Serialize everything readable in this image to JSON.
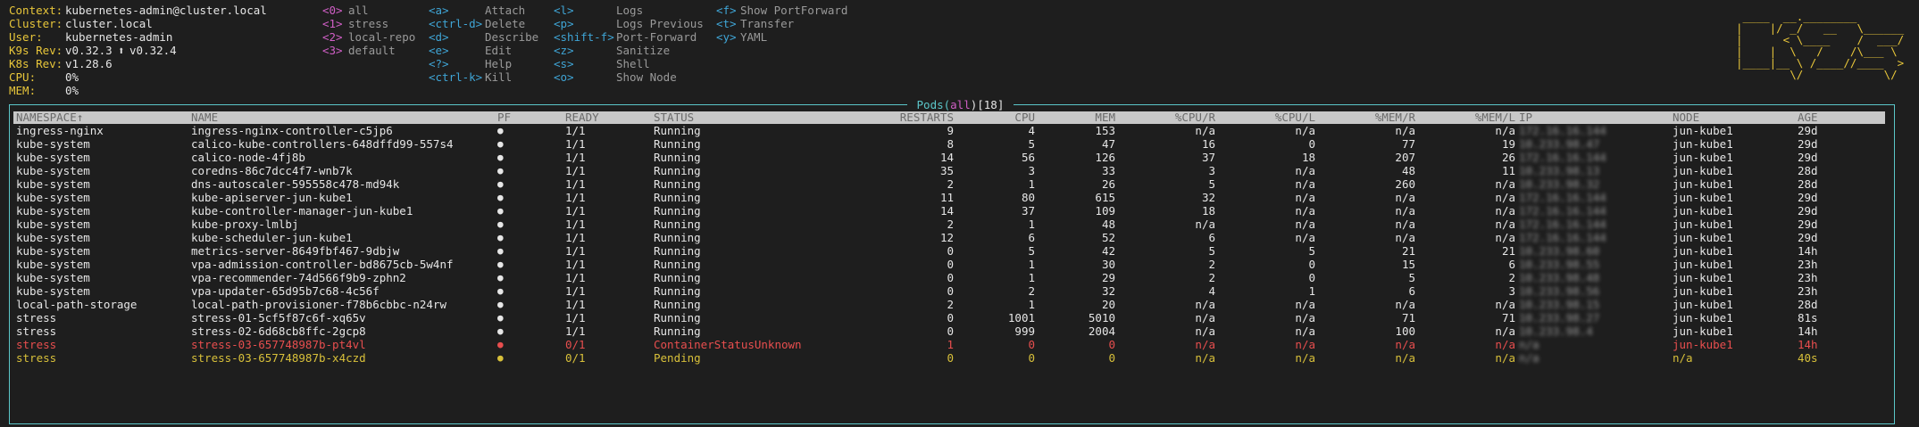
{
  "info": {
    "context_label": "Context:",
    "context": "kubernetes-admin@cluster.local",
    "cluster_label": "Cluster:",
    "cluster": "cluster.local",
    "user_label": "User:",
    "user": "kubernetes-admin",
    "k9s_label": "K9s Rev:",
    "k9s": "v0.32.3",
    "k9s_new": "v0.32.4",
    "k9s_arrow": "⬆",
    "k8s_label": "K8s Rev:",
    "k8s": "v1.28.6",
    "cpu_label": "CPU:",
    "cpu": "0%",
    "mem_label": "MEM:",
    "mem": "0%"
  },
  "namespaces": [
    {
      "key": "<0>",
      "label": "all"
    },
    {
      "key": "<1>",
      "label": "stress"
    },
    {
      "key": "<2>",
      "label": "local-repo"
    },
    {
      "key": "<3>",
      "label": "default"
    }
  ],
  "hotkeys_col1": [
    {
      "key": "<a>",
      "label": "Attach"
    },
    {
      "key": "<ctrl-d>",
      "label": "Delete"
    },
    {
      "key": "<d>",
      "label": "Describe"
    },
    {
      "key": "<e>",
      "label": "Edit"
    },
    {
      "key": "<?>",
      "label": "Help"
    },
    {
      "key": "<ctrl-k>",
      "label": "Kill"
    }
  ],
  "hotkeys_col2": [
    {
      "key": "<l>",
      "label": "Logs"
    },
    {
      "key": "<p>",
      "label": "Logs Previous"
    },
    {
      "key": "<shift-f>",
      "label": "Port-Forward"
    },
    {
      "key": "<z>",
      "label": "Sanitize"
    },
    {
      "key": "<s>",
      "label": "Shell"
    },
    {
      "key": "<o>",
      "label": "Show Node"
    }
  ],
  "hotkeys_col3": [
    {
      "key": "<f>",
      "label": "Show PortForward"
    },
    {
      "key": "<t>",
      "label": "Transfer"
    },
    {
      "key": "<y>",
      "label": "YAML"
    }
  ],
  "logo_lines": [
    " ____  __.________       ",
    "|    |/ _/   __   \\______",
    "|      < \\____    /  ___/",
    "|    |  \\   /    /\\___ \\ ",
    "|____|__ \\ /____//____  >",
    "        \\/            \\/ "
  ],
  "table": {
    "title_prefix": " Pods(",
    "title_ns": "all",
    "title_count": ")[18] ",
    "columns": [
      "NAMESPACE↑",
      "NAME",
      "PF",
      "READY",
      "STATUS",
      "RESTARTS",
      "CPU",
      "MEM",
      "%CPU/R",
      "%CPU/L",
      "%MEM/R",
      "%MEM/L",
      "IP",
      "NODE",
      "AGE"
    ],
    "rows": [
      {
        "state": "norm",
        "ns": "ingress-nginx",
        "name": "ingress-nginx-controller-c5jp6",
        "pf": "●",
        "ready": "1/1",
        "status": "Running",
        "restarts": "9",
        "cpu": "4",
        "mem": "153",
        "cpur": "n/a",
        "cpul": "n/a",
        "memr": "n/a",
        "meml": "n/a",
        "ip": "172.16.16.144",
        "node": "jun-kube1",
        "age": "29d"
      },
      {
        "state": "norm",
        "ns": "kube-system",
        "name": "calico-kube-controllers-648dffd99-557s4",
        "pf": "●",
        "ready": "1/1",
        "status": "Running",
        "restarts": "8",
        "cpu": "5",
        "mem": "47",
        "cpur": "16",
        "cpul": "0",
        "memr": "77",
        "meml": "19",
        "ip": "10.233.98.47",
        "node": "jun-kube1",
        "age": "29d"
      },
      {
        "state": "norm",
        "ns": "kube-system",
        "name": "calico-node-4fj8b",
        "pf": "●",
        "ready": "1/1",
        "status": "Running",
        "restarts": "14",
        "cpu": "56",
        "mem": "126",
        "cpur": "37",
        "cpul": "18",
        "memr": "207",
        "meml": "26",
        "ip": "172.16.16.144",
        "node": "jun-kube1",
        "age": "29d"
      },
      {
        "state": "norm",
        "ns": "kube-system",
        "name": "coredns-86c7dcc4f7-wnb7k",
        "pf": "●",
        "ready": "1/1",
        "status": "Running",
        "restarts": "35",
        "cpu": "3",
        "mem": "33",
        "cpur": "3",
        "cpul": "n/a",
        "memr": "48",
        "meml": "11",
        "ip": "10.233.98.13",
        "node": "jun-kube1",
        "age": "28d"
      },
      {
        "state": "norm",
        "ns": "kube-system",
        "name": "dns-autoscaler-595558c478-md94k",
        "pf": "●",
        "ready": "1/1",
        "status": "Running",
        "restarts": "2",
        "cpu": "1",
        "mem": "26",
        "cpur": "5",
        "cpul": "n/a",
        "memr": "260",
        "meml": "n/a",
        "ip": "10.233.98.32",
        "node": "jun-kube1",
        "age": "28d"
      },
      {
        "state": "norm",
        "ns": "kube-system",
        "name": "kube-apiserver-jun-kube1",
        "pf": "●",
        "ready": "1/1",
        "status": "Running",
        "restarts": "11",
        "cpu": "80",
        "mem": "615",
        "cpur": "32",
        "cpul": "n/a",
        "memr": "n/a",
        "meml": "n/a",
        "ip": "172.16.16.144",
        "node": "jun-kube1",
        "age": "29d"
      },
      {
        "state": "norm",
        "ns": "kube-system",
        "name": "kube-controller-manager-jun-kube1",
        "pf": "●",
        "ready": "1/1",
        "status": "Running",
        "restarts": "14",
        "cpu": "37",
        "mem": "109",
        "cpur": "18",
        "cpul": "n/a",
        "memr": "n/a",
        "meml": "n/a",
        "ip": "172.16.16.144",
        "node": "jun-kube1",
        "age": "29d"
      },
      {
        "state": "norm",
        "ns": "kube-system",
        "name": "kube-proxy-lmlbj",
        "pf": "●",
        "ready": "1/1",
        "status": "Running",
        "restarts": "2",
        "cpu": "1",
        "mem": "48",
        "cpur": "n/a",
        "cpul": "n/a",
        "memr": "n/a",
        "meml": "n/a",
        "ip": "172.16.16.144",
        "node": "jun-kube1",
        "age": "29d"
      },
      {
        "state": "norm",
        "ns": "kube-system",
        "name": "kube-scheduler-jun-kube1",
        "pf": "●",
        "ready": "1/1",
        "status": "Running",
        "restarts": "12",
        "cpu": "6",
        "mem": "52",
        "cpur": "6",
        "cpul": "n/a",
        "memr": "n/a",
        "meml": "n/a",
        "ip": "172.16.16.144",
        "node": "jun-kube1",
        "age": "29d"
      },
      {
        "state": "norm",
        "ns": "kube-system",
        "name": "metrics-server-8649fbf467-9dbjw",
        "pf": "●",
        "ready": "1/1",
        "status": "Running",
        "restarts": "0",
        "cpu": "5",
        "mem": "42",
        "cpur": "5",
        "cpul": "5",
        "memr": "21",
        "meml": "21",
        "ip": "10.233.98.60",
        "node": "jun-kube1",
        "age": "14h"
      },
      {
        "state": "norm",
        "ns": "kube-system",
        "name": "vpa-admission-controller-bd8675cb-5w4nf",
        "pf": "●",
        "ready": "1/1",
        "status": "Running",
        "restarts": "0",
        "cpu": "1",
        "mem": "30",
        "cpur": "2",
        "cpul": "0",
        "memr": "15",
        "meml": "6",
        "ip": "10.233.98.55",
        "node": "jun-kube1",
        "age": "23h"
      },
      {
        "state": "norm",
        "ns": "kube-system",
        "name": "vpa-recommender-74d566f9b9-zphn2",
        "pf": "●",
        "ready": "1/1",
        "status": "Running",
        "restarts": "0",
        "cpu": "1",
        "mem": "29",
        "cpur": "2",
        "cpul": "0",
        "memr": "5",
        "meml": "2",
        "ip": "10.233.98.48",
        "node": "jun-kube1",
        "age": "23h"
      },
      {
        "state": "norm",
        "ns": "kube-system",
        "name": "vpa-updater-65d95b7c68-4c56f",
        "pf": "●",
        "ready": "1/1",
        "status": "Running",
        "restarts": "0",
        "cpu": "2",
        "mem": "32",
        "cpur": "4",
        "cpul": "1",
        "memr": "6",
        "meml": "3",
        "ip": "10.233.98.56",
        "node": "jun-kube1",
        "age": "23h"
      },
      {
        "state": "norm",
        "ns": "local-path-storage",
        "name": "local-path-provisioner-f78b6cbbc-n24rw",
        "pf": "●",
        "ready": "1/1",
        "status": "Running",
        "restarts": "2",
        "cpu": "1",
        "mem": "20",
        "cpur": "n/a",
        "cpul": "n/a",
        "memr": "n/a",
        "meml": "n/a",
        "ip": "10.233.98.15",
        "node": "jun-kube1",
        "age": "28d"
      },
      {
        "state": "norm",
        "ns": "stress",
        "name": "stress-01-5cf5f87c6f-xq65v",
        "pf": "●",
        "ready": "1/1",
        "status": "Running",
        "restarts": "0",
        "cpu": "1001",
        "mem": "5010",
        "cpur": "n/a",
        "cpul": "n/a",
        "memr": "71",
        "meml": "71",
        "ip": "10.233.98.27",
        "node": "jun-kube1",
        "age": "81s"
      },
      {
        "state": "norm",
        "ns": "stress",
        "name": "stress-02-6d68cb8ffc-2gcp8",
        "pf": "●",
        "ready": "1/1",
        "status": "Running",
        "restarts": "0",
        "cpu": "999",
        "mem": "2004",
        "cpur": "n/a",
        "cpul": "n/a",
        "memr": "100",
        "meml": "n/a",
        "ip": "10.233.98.4",
        "node": "jun-kube1",
        "age": "14h"
      },
      {
        "state": "err",
        "ns": "stress",
        "name": "stress-03-657748987b-pt4vl",
        "pf": "●",
        "ready": "0/1",
        "status": "ContainerStatusUnknown",
        "restarts": "1",
        "cpu": "0",
        "mem": "0",
        "cpur": "n/a",
        "cpul": "n/a",
        "memr": "n/a",
        "meml": "n/a",
        "ip": "n/a",
        "node": "jun-kube1",
        "age": "14h"
      },
      {
        "state": "pend",
        "ns": "stress",
        "name": "stress-03-657748987b-x4czd",
        "pf": "●",
        "ready": "0/1",
        "status": "Pending",
        "restarts": "0",
        "cpu": "0",
        "mem": "0",
        "cpur": "n/a",
        "cpul": "n/a",
        "memr": "n/a",
        "meml": "n/a",
        "ip": "n/a",
        "node": "n/a",
        "age": "40s"
      }
    ]
  }
}
